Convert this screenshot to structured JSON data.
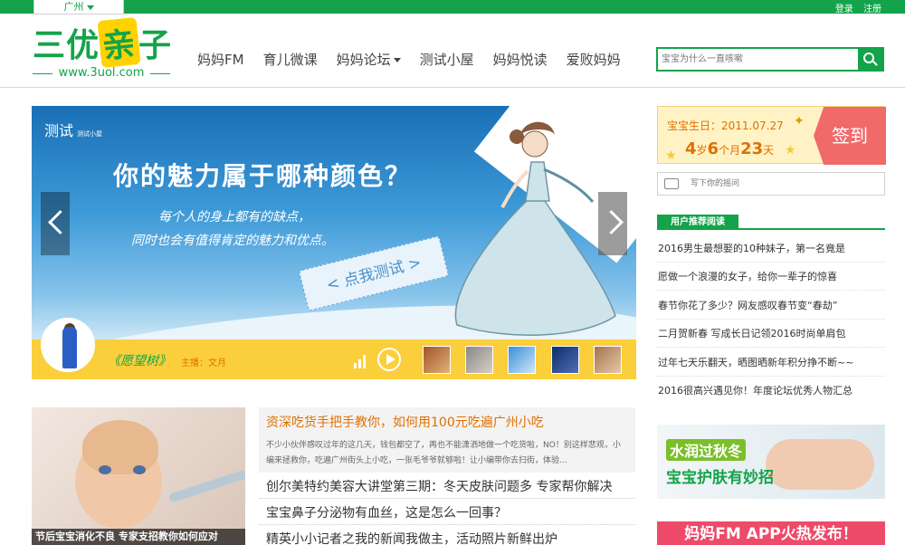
{
  "topbar": {
    "city": "广州",
    "login": "登录",
    "register": "注册"
  },
  "logo": {
    "text_a": "三优",
    "text_b": "亲",
    "text_c": "子",
    "url": "www.3uol.com"
  },
  "nav": {
    "items": [
      "妈妈FM",
      "育儿微课",
      "妈妈论坛",
      "测试小屋",
      "妈妈悦读",
      "爱败妈妈"
    ]
  },
  "search": {
    "placeholder": "宝宝为什么一直咳嗽"
  },
  "banner": {
    "brand": "测试",
    "brand_sub": "测试小屋",
    "title": "你的魅力属于哪种颜色？",
    "line1": "每个人的身上都有的缺点，",
    "line2": "同时也会有值得肯定的魅力和优点。",
    "cta": "< 点我测试 >",
    "track": "《愿望树》",
    "host": "主播：文月"
  },
  "feature": {
    "caption": "节后宝宝消化不良 专家支招教你如何应对"
  },
  "lead": {
    "title": "资深吃货手把手教你，如何用100元吃遍广州小吃",
    "body": "不少小伙伴感叹过年的这几天，钱包都空了，再也不能潇洒地做一个吃货啦，NO！别这样悲观，小编来拯救你，吃遍广州街头上小吃，一张毛爷爷就够啦！让小编带你去扫街，体验..."
  },
  "stories": [
    "创尔美特约美容大讲堂第三期：冬天皮肤问题多 专家帮你解决",
    "宝宝鼻子分泌物有血丝，这是怎么一回事？",
    "精英小小记者之我的新闻我做主，活动照片新鲜出炉"
  ],
  "birthday": {
    "label": "宝宝生日：2011.07.27",
    "age_y": "4",
    "age_y_unit": "岁",
    "age_m": "6",
    "age_m_unit": "个月",
    "age_d": "23",
    "age_d_unit": "天",
    "signin": "签到"
  },
  "comment": {
    "placeholder": "写下你的摇问"
  },
  "recommend": {
    "title": "用户推荐阅读",
    "items": [
      "2016男生最想娶的10种妹子，第一名竟是",
      "愿做一个浪漫的女子，给你一辈子的惊喜",
      "春节你花了多少？网友感叹春节变“春劫”",
      "二月贺新春 写成长日记领2016时尚单肩包",
      "过年七天乐翻天，晒图晒新年积分挣不断~~",
      "2016很高兴遇见你！年度论坛优秀人物汇总"
    ]
  },
  "ads": {
    "ad1_line1": "水润过秋冬",
    "ad1_line2": "宝宝护肤有妙招",
    "ad2": "妈妈FM APP火热发布！"
  },
  "colors": {
    "brand_green": "#14a34a",
    "accent_orange": "#e07000",
    "player_yellow": "#fbcf3b",
    "signin_red": "#f06a6a"
  }
}
